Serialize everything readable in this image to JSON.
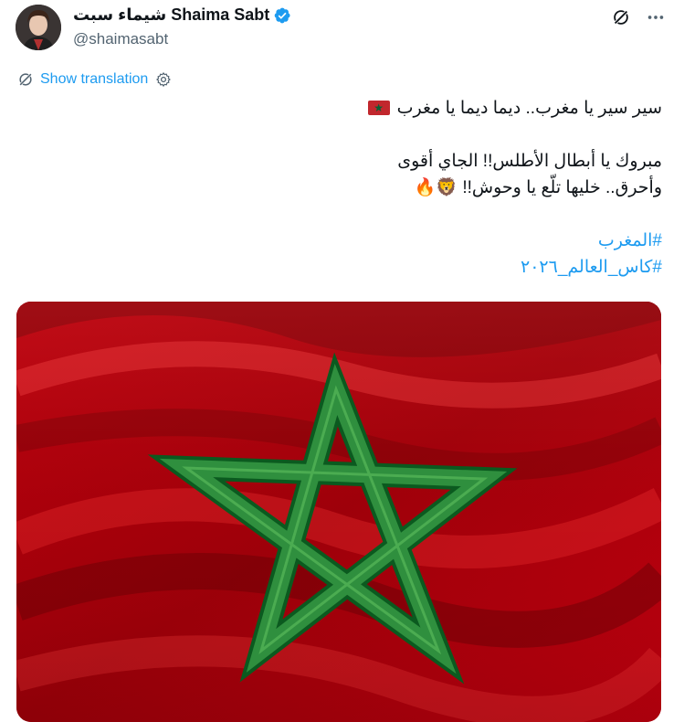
{
  "author": {
    "display_name": "شيماء سبت Shaima Sabt",
    "handle": "@shaimasabt",
    "verified": true
  },
  "icons": {
    "grok": "grok-icon",
    "more": "more-icon",
    "translate": "translate-icon",
    "settings": "gear-icon",
    "verified": "verified-badge-icon"
  },
  "translation": {
    "label": "Show translation"
  },
  "tweet": {
    "line1": "سير سير يا مغرب.. ديما ديما يا مغرب",
    "line2": "مبروك يا أبطال الأطلس!! الجاي أقوى",
    "line3": "وأحرق.. خليها تلّع يا وحوش!!",
    "line3_emoji": "🦁🔥",
    "hashtag1": "#المغرب",
    "hashtag2": "#كاس_العالم_٢٠٢٦"
  },
  "colors": {
    "accent": "#1d9bf0",
    "flag_red": "#c1272d",
    "flag_green": "#006233"
  }
}
